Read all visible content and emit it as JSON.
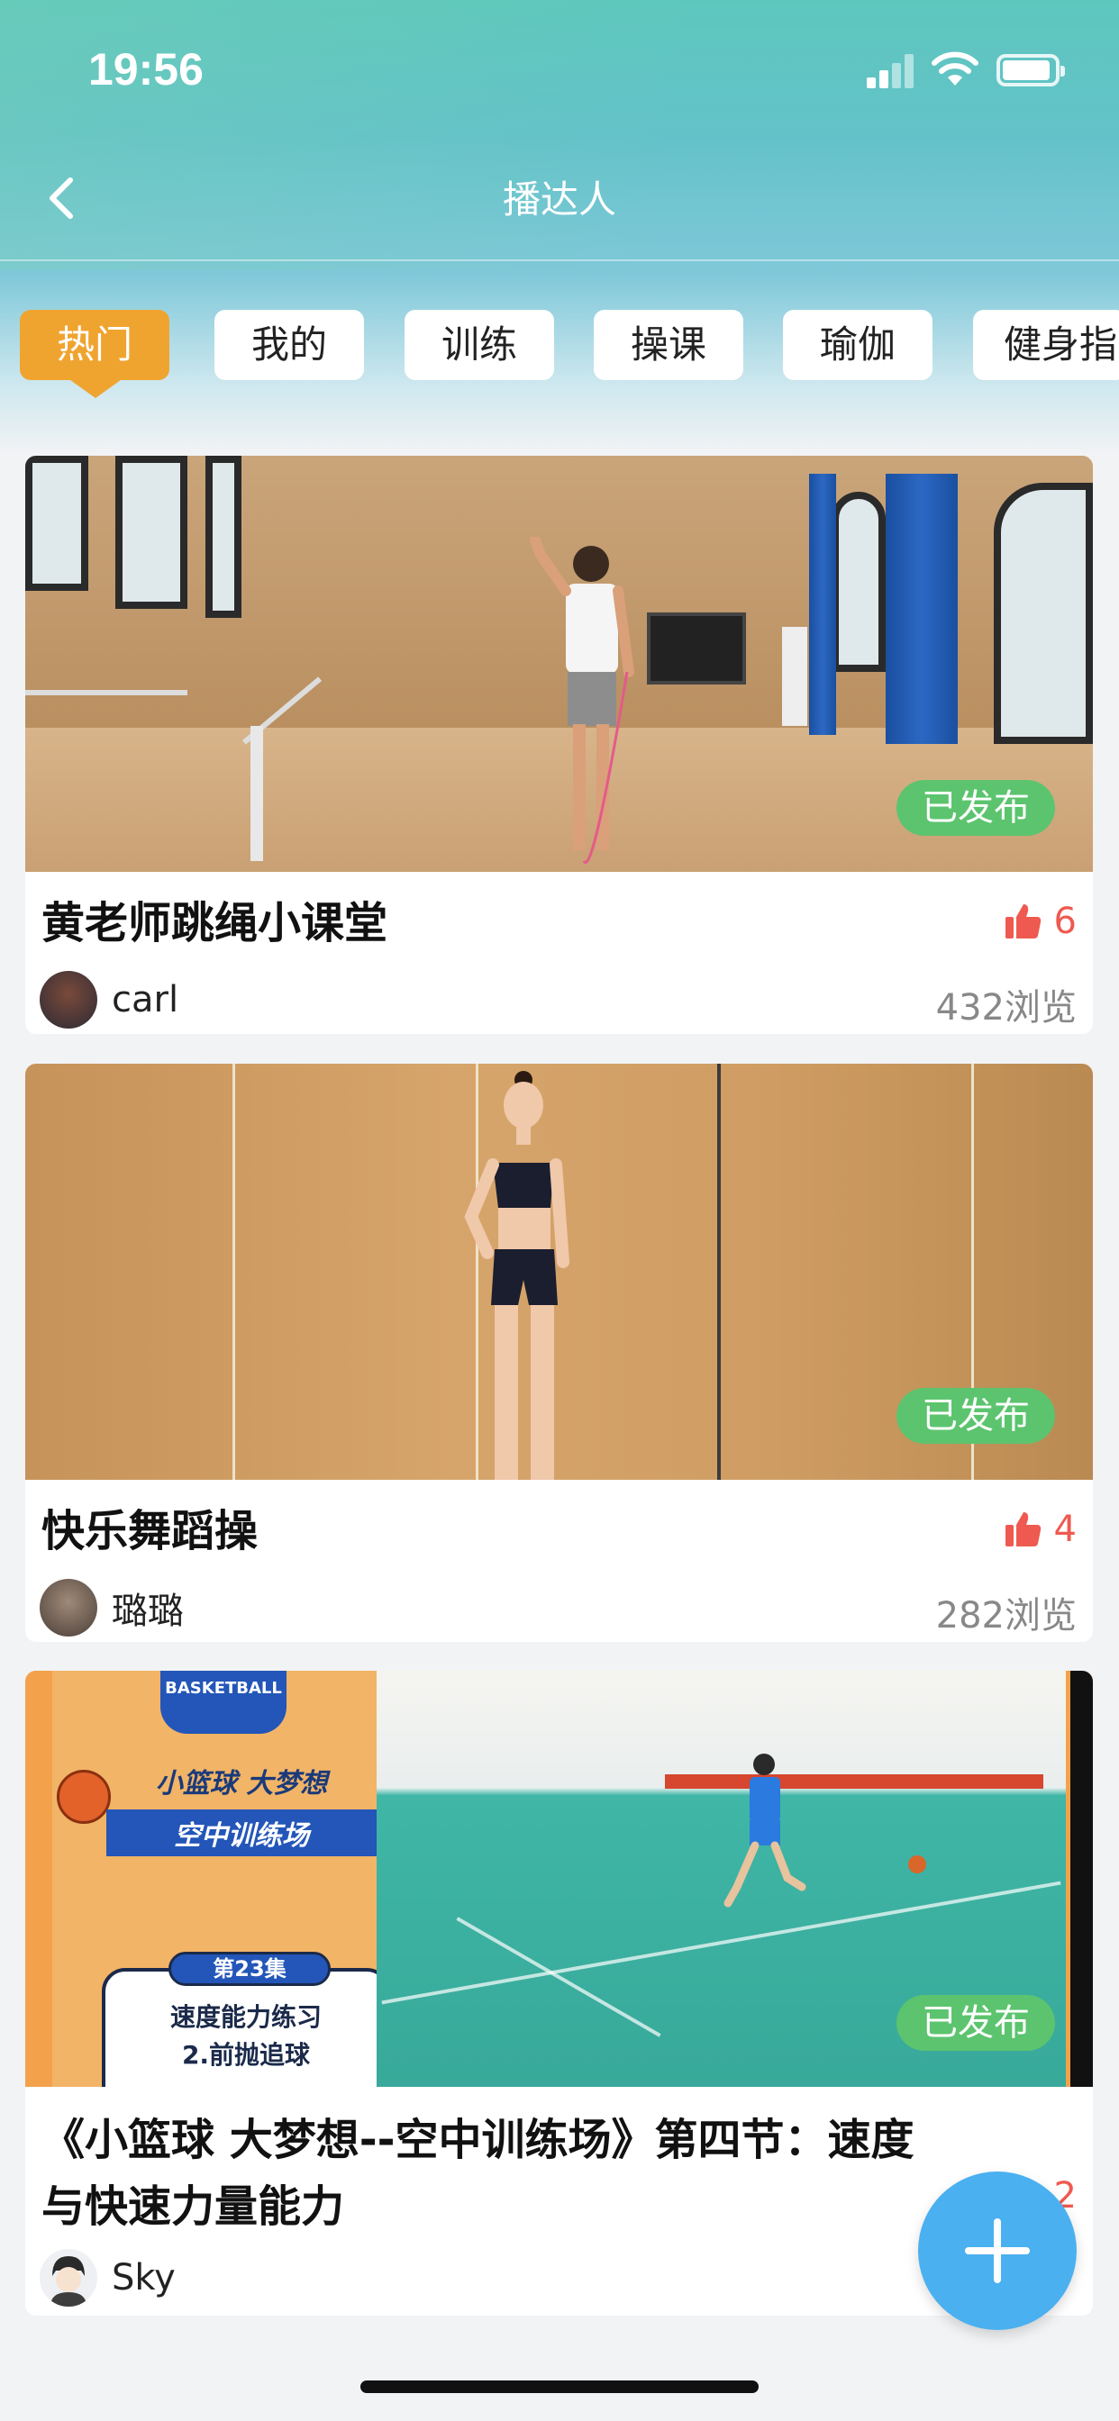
{
  "status_bar": {
    "time": "19:56"
  },
  "nav": {
    "title": "播达人",
    "back_icon": "chevron-left-icon"
  },
  "tabs": [
    {
      "label": "热门",
      "active": true
    },
    {
      "label": "我的",
      "active": false
    },
    {
      "label": "训练",
      "active": false
    },
    {
      "label": "操课",
      "active": false
    },
    {
      "label": "瑜伽",
      "active": false
    },
    {
      "label": "健身指",
      "active": false
    }
  ],
  "cards": [
    {
      "badge": "已发布",
      "title": "黄老师跳绳小课堂",
      "likes": "6",
      "author": "carl",
      "views": "432浏览"
    },
    {
      "badge": "已发布",
      "title": "快乐舞蹈操",
      "likes": "4",
      "author": "璐璐",
      "views": "282浏览"
    },
    {
      "badge": "已发布",
      "title_line1": "《小篮球 大梦想--空中训练场》第四节：速度",
      "title_line2": "与快速力量能力",
      "likes": "2",
      "author": "Sky",
      "poster": {
        "brand": "BASKETBALL",
        "heading1": "小篮球 大梦想",
        "heading2": "空中训练场",
        "episode": "第23集",
        "line1": "速度能力练习",
        "line2": "2.前抛追球"
      }
    }
  ],
  "colors": {
    "active_tab": "#f0a430",
    "badge": "#5cc46e",
    "like": "#ee5a50",
    "fab": "#4ab0f0"
  },
  "fab_icon": "plus-icon"
}
